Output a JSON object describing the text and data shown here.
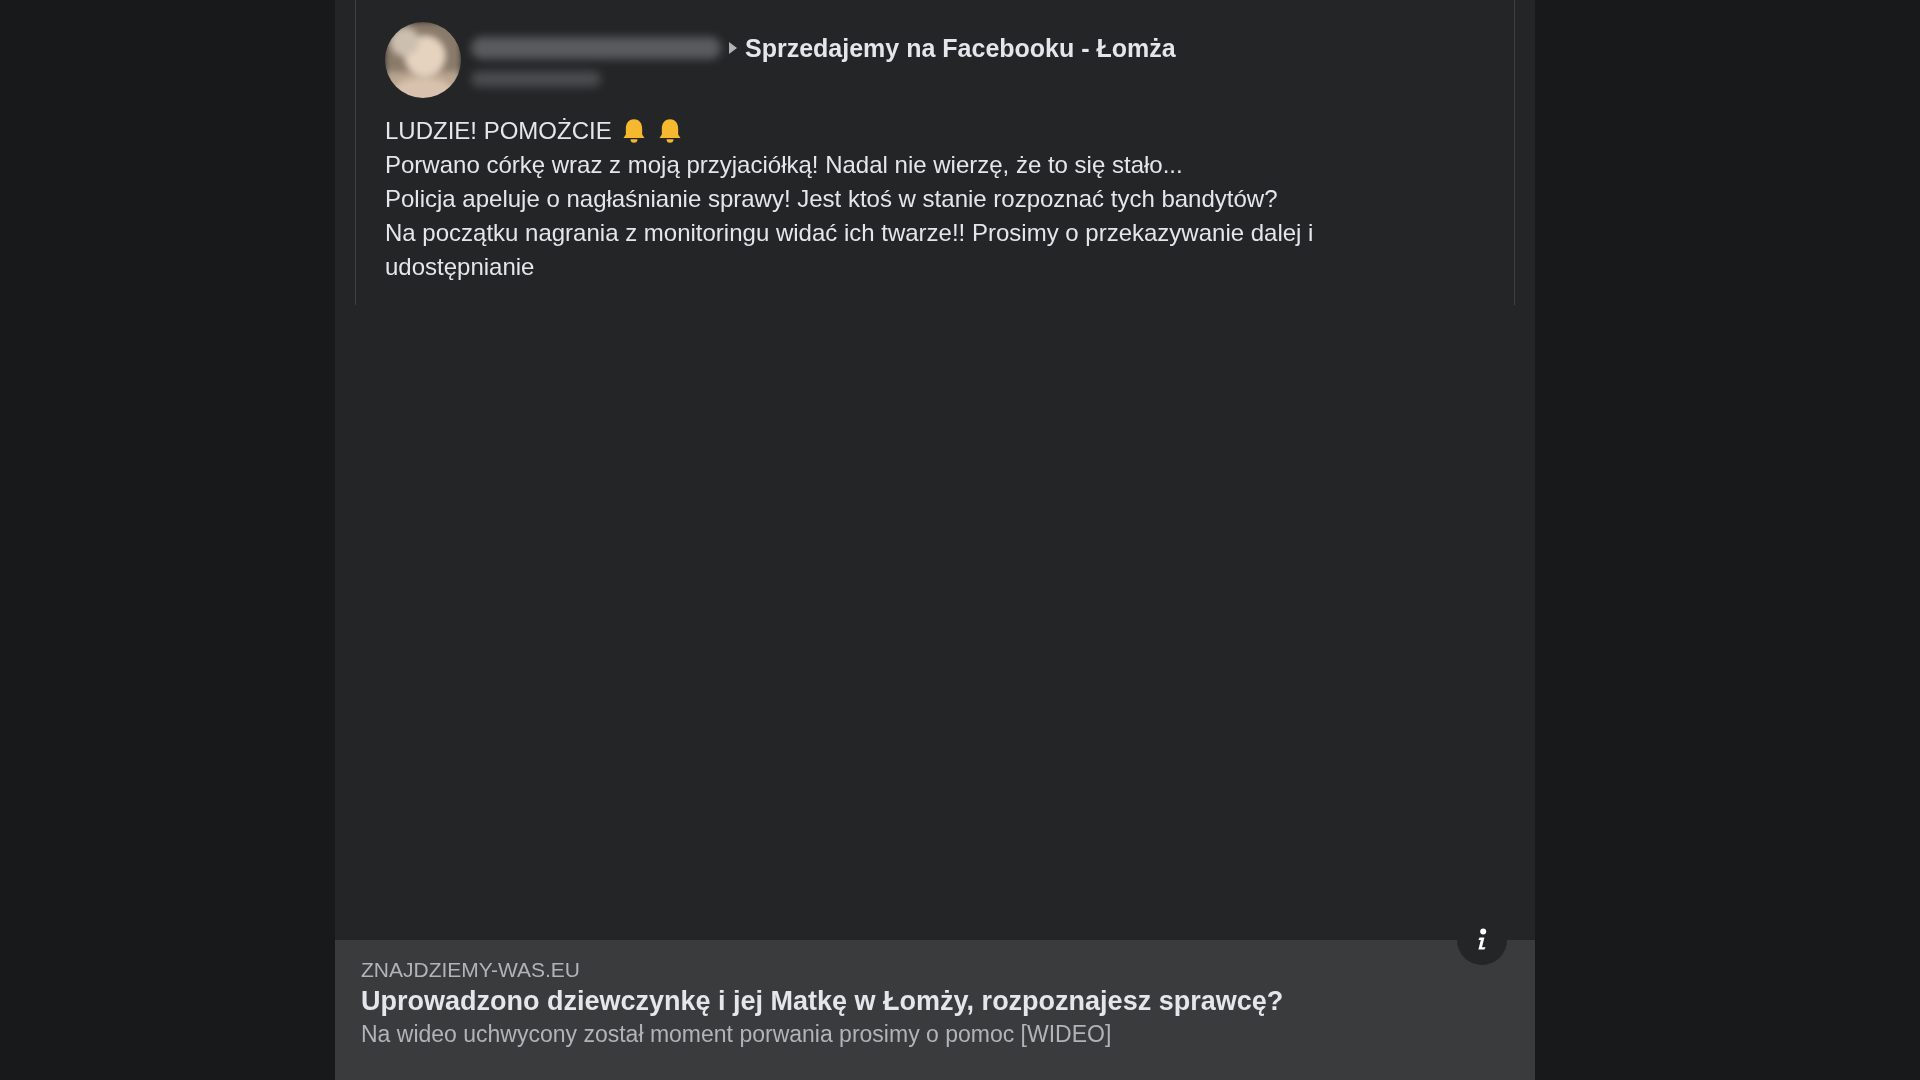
{
  "post": {
    "group": "Sprzedajemy na Facebooku - Łomża",
    "title": "LUDZIE! POMOŻCIE",
    "lines": [
      "Porwano córkę wraz z moją przyjaciółką! Nadal nie wierzę, że to się stało...",
      "Policja apeluje o nagłaśnianie sprawy! Jest ktoś w stanie rozpoznać tych bandytów?",
      "Na początku nagrania z monitoringu widać ich twarze!! Prosimy o przekazywanie dalej i",
      "udostępnianie"
    ]
  },
  "link": {
    "domain": "ZNAJDZIEMY-WAS.EU",
    "headline": "Uprowadzono dziewczynkę i jej Matkę w Łomży, rozpoznajesz sprawcę?",
    "description": "Na wideo uchwycony został moment porwania prosimy o pomoc [WIDEO]"
  }
}
